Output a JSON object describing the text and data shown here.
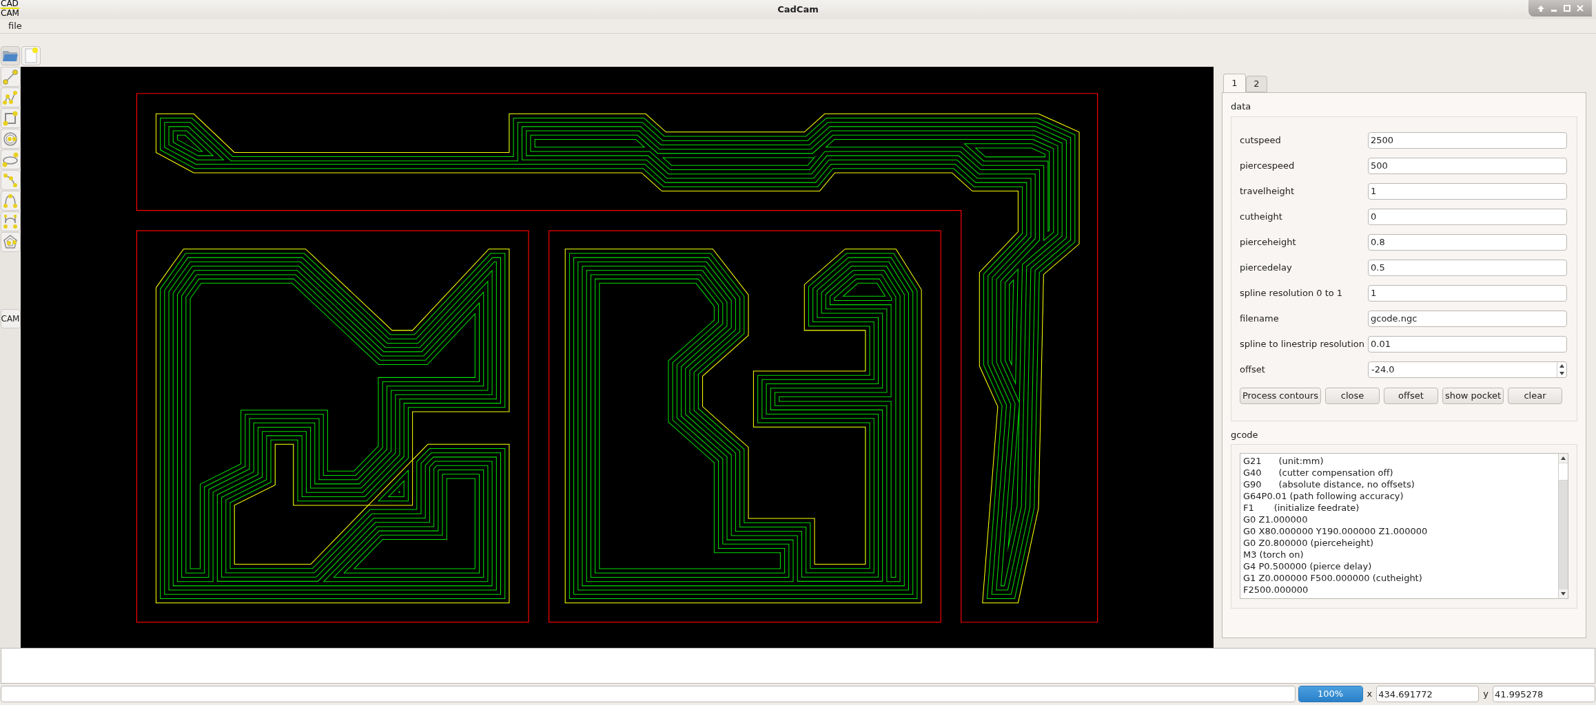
{
  "window": {
    "title": "CadCam",
    "logo_lines": [
      "CAD",
      "CAM"
    ]
  },
  "menu": [
    "file"
  ],
  "side_panel_button": "CAM",
  "tabs": [
    {
      "label": "1",
      "selected": true
    },
    {
      "label": "2",
      "selected": false
    }
  ],
  "data_group": {
    "title": "data",
    "fields": [
      {
        "label": "cutspeed",
        "value": "2500",
        "kind": "text"
      },
      {
        "label": "piercespeed",
        "value": "500",
        "kind": "text"
      },
      {
        "label": "travelheight",
        "value": "1",
        "kind": "text"
      },
      {
        "label": "cutheight",
        "value": "0",
        "kind": "text"
      },
      {
        "label": "pierceheight",
        "value": "0.8",
        "kind": "text"
      },
      {
        "label": "piercedelay",
        "value": "0.5",
        "kind": "text"
      },
      {
        "label": "spline resolution 0 to 1",
        "value": "1",
        "kind": "text"
      },
      {
        "label": "filename",
        "value": "gcode.ngc",
        "kind": "text"
      },
      {
        "label": "spline to linestrip resolution",
        "value": "0.01",
        "kind": "text"
      },
      {
        "label": "offset",
        "value": "-24.0",
        "kind": "spin"
      }
    ],
    "buttons": [
      "Process contours",
      "close",
      "offset",
      "show pocket",
      "clear"
    ]
  },
  "gcode_group": {
    "title": "gcode",
    "lines": [
      "G21      (unit:mm)",
      "G40      (cutter compensation off)",
      "G90      (absolute distance, no offsets)",
      "G64P0.01 (path following accuracy)",
      "F1       (initialize feedrate)",
      "G0 Z1.000000",
      "G0 X80.000000 Y190.000000 Z1.000000",
      "G0 Z0.800000 (pierceheight)",
      "M3 (torch on)",
      "G4 P0.500000 (pierce delay)",
      "G1 Z0.000000 F500.000000 (cutheight)",
      "F2500.000000"
    ]
  },
  "status_bar": {
    "progress": {
      "level": 1,
      "text": "100%"
    },
    "x_label": "x",
    "x_value": "434.691772",
    "y_label": "y",
    "y_value": "41.995278"
  }
}
